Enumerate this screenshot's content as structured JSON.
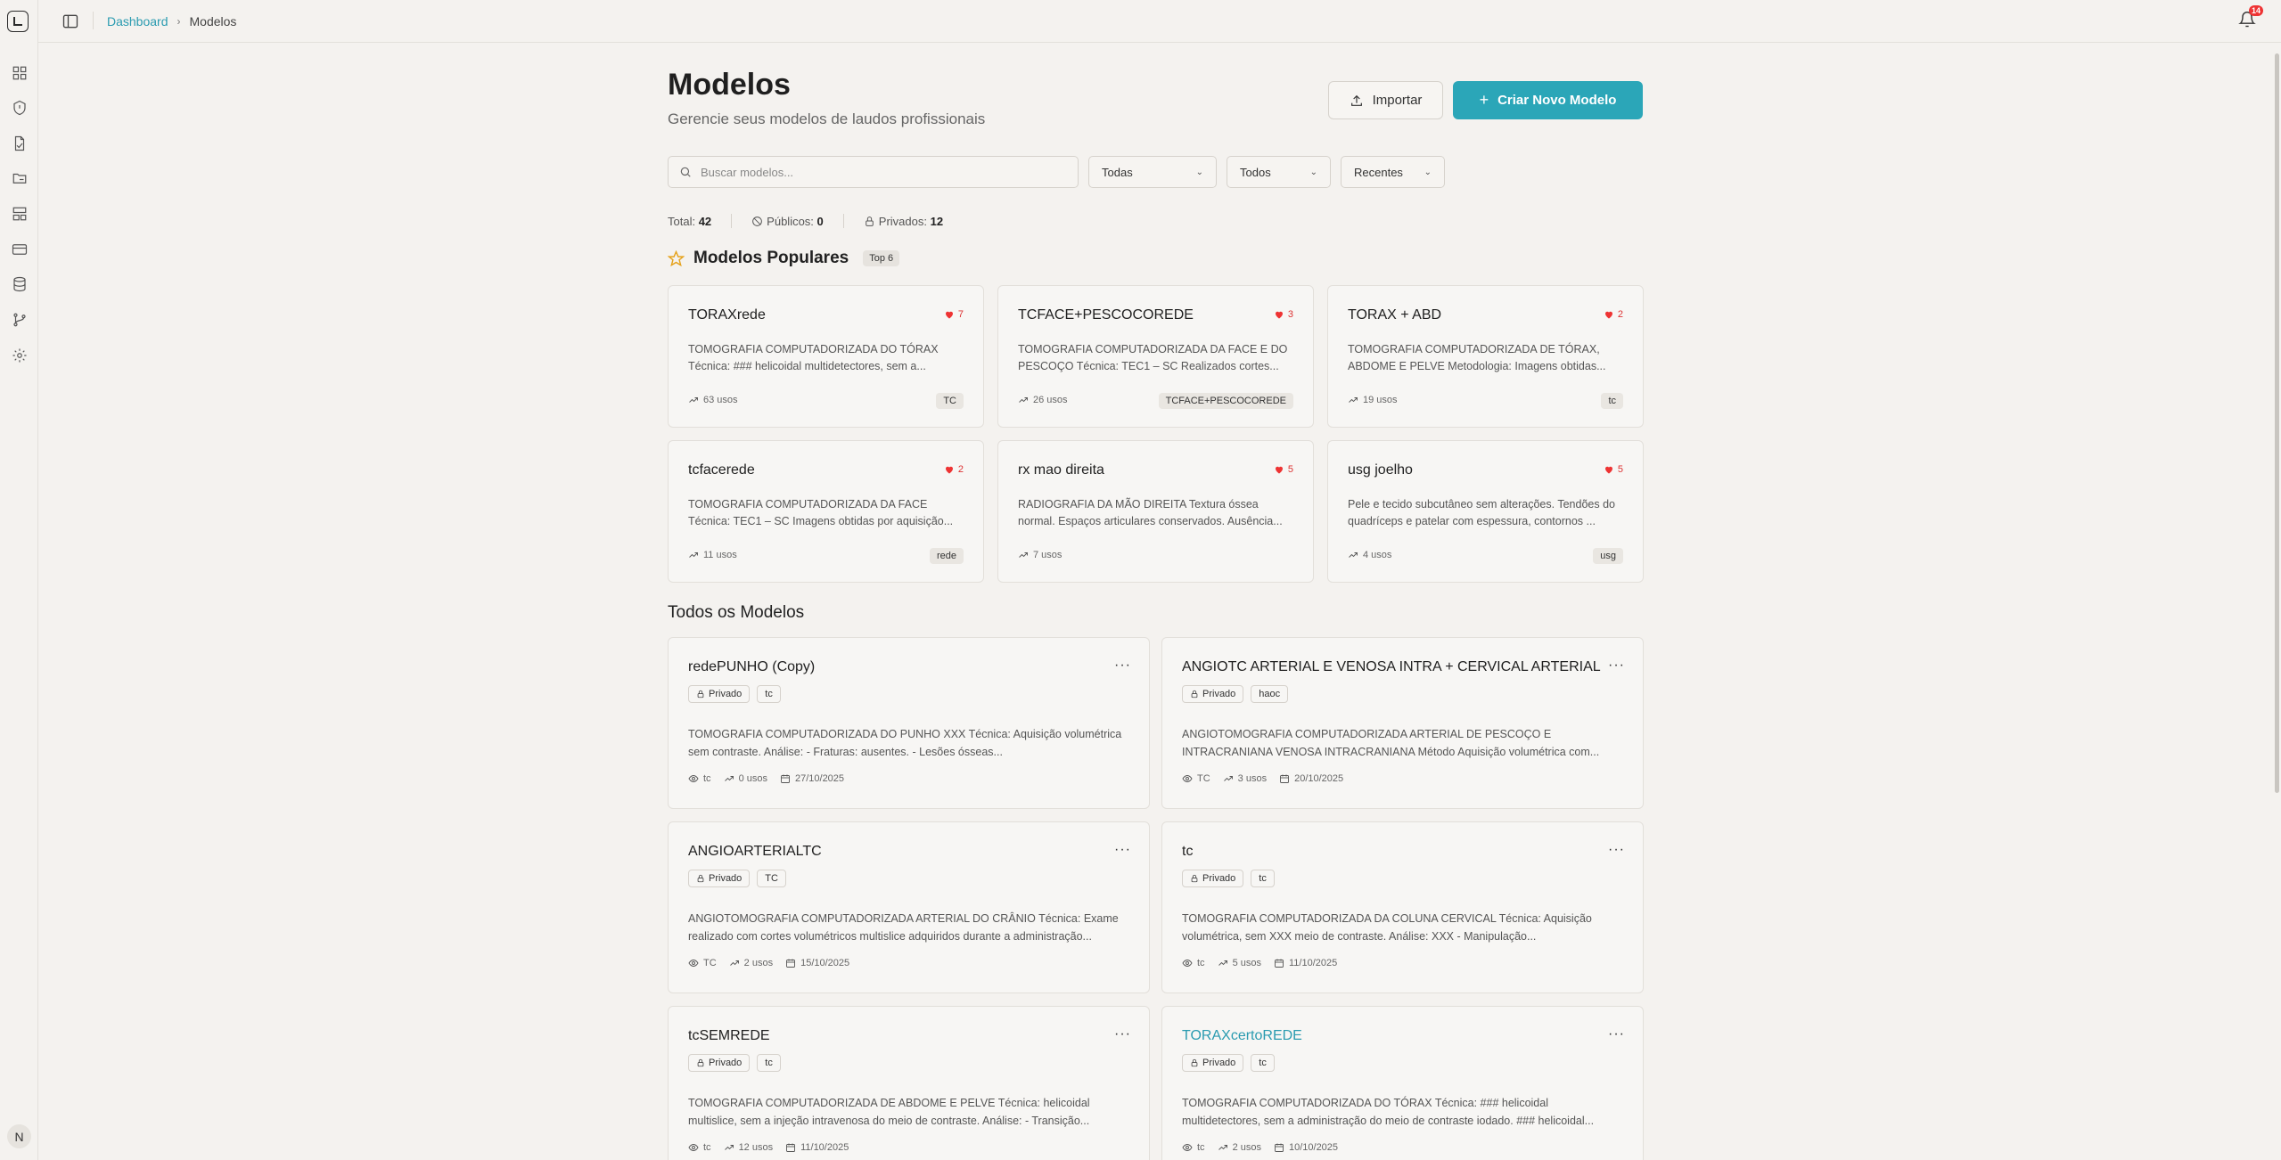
{
  "topbar": {
    "breadcrumb_home": "Dashboard",
    "breadcrumb_current": "Modelos",
    "notifications_count": "14"
  },
  "sidebar": {
    "avatar_initial": "N",
    "icons": [
      "layout-grid-icon",
      "shield-icon",
      "file-icon",
      "folder-icon",
      "template-icon",
      "card-icon",
      "database-icon",
      "git-branch-icon",
      "settings-icon"
    ]
  },
  "header": {
    "title": "Modelos",
    "subtitle": "Gerencie seus modelos de laudos profissionais",
    "import_label": "Importar",
    "new_label": "Criar Novo Modelo"
  },
  "filters": {
    "search_placeholder": "Buscar modelos...",
    "category": "Todas",
    "visibility": "Todos",
    "sort": "Recentes"
  },
  "stats": {
    "total_label": "Total:",
    "total": "42",
    "public_label": "Públicos:",
    "public": "0",
    "private_label": "Privados:",
    "private": "12"
  },
  "popular": {
    "title": "Modelos Populares",
    "badge": "Top 6",
    "items": [
      {
        "title": "TORAXrede",
        "likes": "7",
        "desc": "TOMOGRAFIA COMPUTADORIZADA DO TÓRAX Técnica:  ### helicoidal multidetectores, sem a...",
        "uses": "63 usos",
        "tag": "TC"
      },
      {
        "title": "TCFACE+PESCOCOREDE",
        "likes": "3",
        "desc": "TOMOGRAFIA COMPUTADORIZADA DA FACE E DO PESCOÇO Técnica: TEC1 – SC  Realizados cortes...",
        "uses": "26 usos",
        "tag": "TCFACE+PESCOCOREDE"
      },
      {
        "title": "TORAX + ABD",
        "likes": "2",
        "desc": "TOMOGRAFIA COMPUTADORIZADA DE TÓRAX, ABDOME E PELVE Metodologia: Imagens obtidas...",
        "uses": "19 usos",
        "tag": "tc"
      },
      {
        "title": "tcfacerede",
        "likes": "2",
        "desc": "TOMOGRAFIA COMPUTADORIZADA DA FACE Técnica: TEC1 – SC  Imagens obtidas por aquisição...",
        "uses": "11 usos",
        "tag": "rede"
      },
      {
        "title": "rx mao direita",
        "likes": "5",
        "desc": "RADIOGRAFIA DA MÃO DIREITA Textura óssea normal. Espaços articulares conservados. Ausência...",
        "uses": "7 usos",
        "tag": ""
      },
      {
        "title": "usg joelho",
        "likes": "5",
        "desc": "Pele e tecido subcutâneo sem alterações. Tendões do quadríceps e patelar com espessura, contornos ...",
        "uses": "4 usos",
        "tag": "usg"
      }
    ]
  },
  "all": {
    "title": "Todos os Modelos",
    "items": [
      {
        "title": "redePUNHO (Copy)",
        "visibility": "Privado",
        "tag": "tc",
        "desc": "TOMOGRAFIA COMPUTADORIZADA DO PUNHO XXX   Técnica: Aquisição volumétrica sem contraste. Análise: - Fraturas: ausentes. - Lesões ósseas...",
        "meta_tag": "tc",
        "uses": "0 usos",
        "date": "27/10/2025"
      },
      {
        "title": "ANGIOTC ARTERIAL E VENOSA INTRA + CERVICAL ARTERIAL",
        "visibility": "Privado",
        "tag": "haoc",
        "desc": "ANGIOTOMOGRAFIA COMPUTADORIZADA ARTERIAL DE PESCOÇO E INTRACRANIANA VENOSA INTRACRANIANA Método Aquisição volumétrica com...",
        "meta_tag": "TC",
        "uses": "3 usos",
        "date": "20/10/2025"
      },
      {
        "title": "ANGIOARTERIALTC",
        "visibility": "Privado",
        "tag": "TC",
        "desc": "ANGIOTOMOGRAFIA COMPUTADORIZADA ARTERIAL DO CRÂNIO Técnica: Exame realizado com cortes volumétricos multislice adquiridos durante a administração...",
        "meta_tag": "TC",
        "uses": "2 usos",
        "date": "15/10/2025"
      },
      {
        "title": "tc",
        "visibility": "Privado",
        "tag": "tc",
        "desc": "TOMOGRAFIA COMPUTADORIZADA DA COLUNA CERVICAL   Técnica: Aquisição volumétrica, sem XXX meio de contraste. Análise: XXX - Manipulação...",
        "meta_tag": "tc",
        "uses": "5 usos",
        "date": "11/10/2025"
      },
      {
        "title": "tcSEMREDE",
        "visibility": "Privado",
        "tag": "tc",
        "desc": "TOMOGRAFIA COMPUTADORIZADA DE ABDOME E PELVE Técnica: helicoidal multislice, sem a injeção intravenosa do meio de contraste. Análise: - Transição...",
        "meta_tag": "tc",
        "uses": "12 usos",
        "date": "11/10/2025"
      },
      {
        "title": "TORAXcertoREDE",
        "visibility": "Privado",
        "tag": "tc",
        "desc": "TOMOGRAFIA COMPUTADORIZADA DO TÓRAX  Técnica:  ### helicoidal multidetectores, sem a administração do meio de contraste iodado.  ### helicoidal...",
        "meta_tag": "tc",
        "uses": "2 usos",
        "date": "10/10/2025"
      }
    ]
  }
}
